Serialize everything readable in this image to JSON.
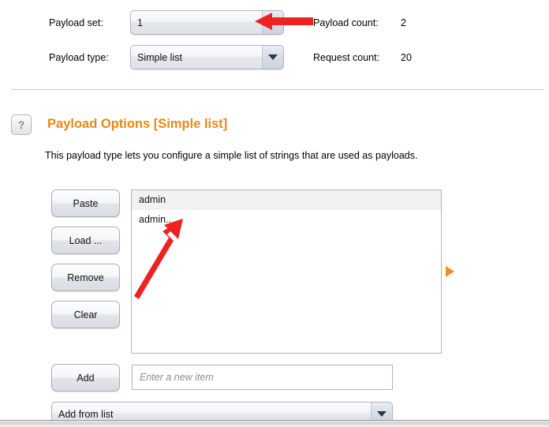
{
  "top_form": {
    "payload_set_label": "Payload set:",
    "payload_set_value": "1",
    "payload_type_label": "Payload type:",
    "payload_type_value": "Simple list",
    "payload_count_label": "Payload count:",
    "payload_count_value": "2",
    "request_count_label": "Request count:",
    "request_count_value": "20"
  },
  "section": {
    "help_icon_glyph": "?",
    "title": "Payload Options [Simple list]",
    "description": "This payload type lets you configure a simple list of strings that are used as payloads.",
    "title_color": "#e58a12"
  },
  "list_controls": {
    "buttons": [
      {
        "label": "Paste",
        "name": "paste-button"
      },
      {
        "label": "Load ...",
        "name": "load-button"
      },
      {
        "label": "Remove",
        "name": "remove-button"
      },
      {
        "label": "Clear",
        "name": "clear-button"
      }
    ],
    "items": [
      {
        "text": "admin"
      },
      {
        "text": "admin.."
      }
    ]
  },
  "add_row": {
    "add_button_label": "Add",
    "new_item_placeholder": "Enter a new item",
    "new_item_value": ""
  },
  "add_from_list": {
    "selected": "Add from list"
  },
  "icons": {
    "expand_triangle": "triangle-right-icon",
    "dropdown_arrow": "chevron-down-icon"
  },
  "annotations": {
    "arrow_color": "#ee2222",
    "arrow_top_target": "payload-set-combo",
    "arrow_list_target": "payload-list-item-2"
  }
}
